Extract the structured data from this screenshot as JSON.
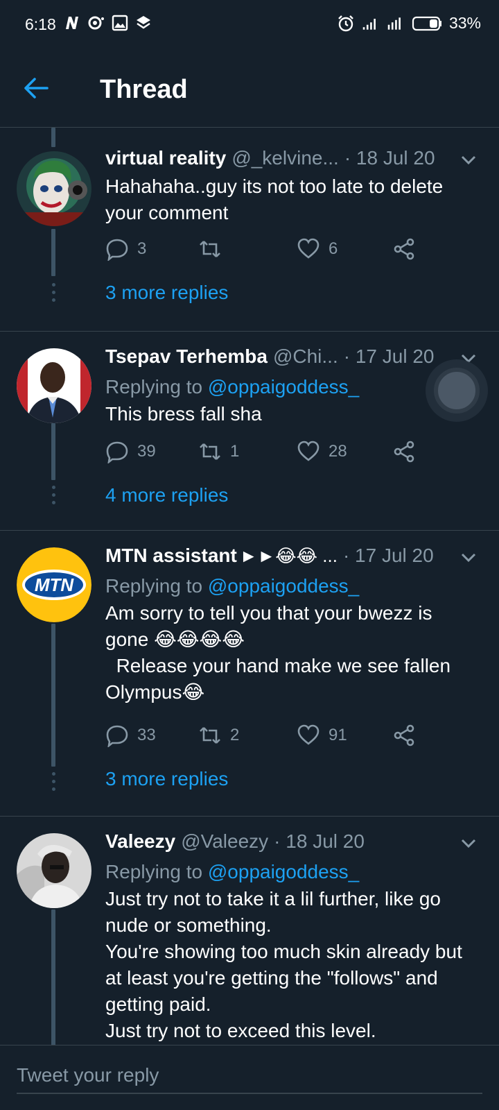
{
  "status_bar": {
    "time": "6:18",
    "battery": "33%"
  },
  "header": {
    "title": "Thread"
  },
  "tweets": [
    {
      "name": "virtual reality",
      "handle": "@_kelvine...",
      "date": "· 18 Jul 20",
      "replying_prefix": "",
      "replying_to": "",
      "text": "Hahahaha..guy its not too late to delete your comment",
      "replies": "3",
      "retweets": "",
      "likes": "6",
      "more_replies": "3 more replies"
    },
    {
      "name": "Tsepav Terhemba",
      "handle": "@Chi...",
      "date": "· 17 Jul 20",
      "replying_prefix": "Replying to ",
      "replying_to": "@oppaigoddess_",
      "text": "This bress fall sha",
      "replies": "39",
      "retweets": "1",
      "likes": "28",
      "more_replies": "4 more replies"
    },
    {
      "name": "MTN assistant",
      "name_suffix": "►►😂😂 ...",
      "handle": "",
      "date": "· 17 Jul 20",
      "replying_prefix": "Replying to ",
      "replying_to": "@oppaigoddess_",
      "text": "Am sorry to tell you that your bwezz is gone 😂😂😂😂\n  Release your hand make we see fallen Olympus😂",
      "replies": "33",
      "retweets": "2",
      "likes": "91",
      "more_replies": "3 more replies",
      "avatar_text": "MTN"
    },
    {
      "name": "Valeezy",
      "handle": "@Valeezy",
      "date": "· 18 Jul 20",
      "replying_prefix": "Replying to ",
      "replying_to": "@oppaigoddess_",
      "text": "Just try not to take it a lil further, like go nude or something.\nYou're showing too much skin already but at least you're getting the \"follows\" and getting paid.\nJust try not to exceed this level."
    }
  ],
  "composer": {
    "placeholder": "Tweet your reply"
  },
  "colors": {
    "background": "#15202b",
    "accent": "#1da1f2",
    "muted": "#8899a6",
    "divider": "#38444d",
    "mtn_yellow": "#ffc20e",
    "mtn_blue": "#0d4c9c"
  }
}
